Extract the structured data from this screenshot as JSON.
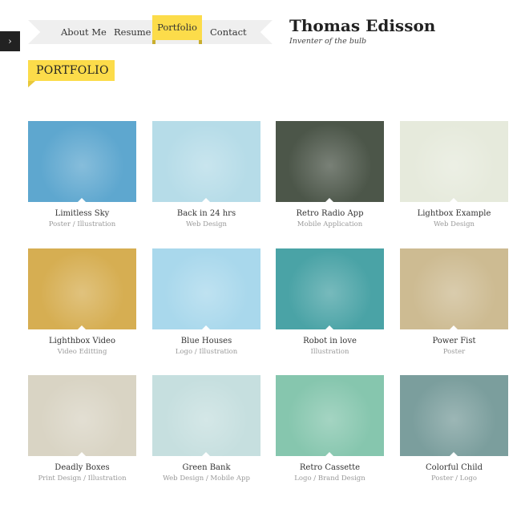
{
  "nav": {
    "toggle_icon": "chevron-right-icon",
    "items": [
      "About Me",
      "Resume",
      "Portfolio",
      "Contact"
    ],
    "active": "Portfolio"
  },
  "site": {
    "title": "Thomas Edisson",
    "subtitle": "Inventer of the bulb"
  },
  "page_title": "PORTFOLIO",
  "accent": "#fcdc4a",
  "portfolio": [
    {
      "title": "Limitless Sky",
      "category": "Poster / Illustration",
      "color": "#5ea7cf"
    },
    {
      "title": "Back in 24 hrs",
      "category": "Web Design",
      "color": "#b6dce8"
    },
    {
      "title": "Retro Radio App",
      "category": "Mobile Application",
      "color": "#4c5649"
    },
    {
      "title": "Lightbox Example",
      "category": "Web Design",
      "color": "#e6eadc"
    },
    {
      "title": "Lighthbox Video",
      "category": "Video Editting",
      "color": "#d6ae52"
    },
    {
      "title": "Blue Houses",
      "category": "Logo / Illustration",
      "color": "#a9d8ec"
    },
    {
      "title": "Robot in love",
      "category": "Illustration",
      "color": "#4aa3a6"
    },
    {
      "title": "Power Fist",
      "category": "Poster",
      "color": "#cdbb92"
    },
    {
      "title": "Deadly Boxes",
      "category": "Print Design / Illustration",
      "color": "#d9d4c4"
    },
    {
      "title": "Green Bank",
      "category": "Web Design / Mobile App",
      "color": "#c6dfdf"
    },
    {
      "title": "Retro Cassette",
      "category": "Logo / Brand Design",
      "color": "#86c6ae"
    },
    {
      "title": "Colorful Child",
      "category": "Poster / Logo",
      "color": "#7b9e9d"
    }
  ]
}
